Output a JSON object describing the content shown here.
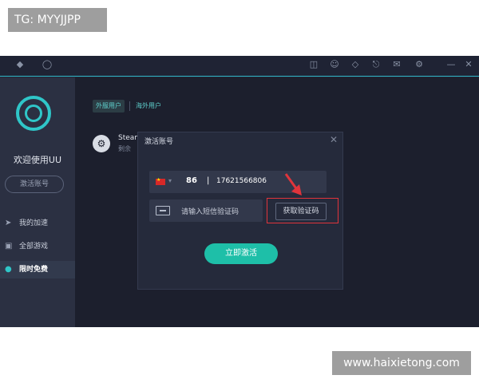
{
  "watermarks": {
    "top": "TG: MYYJJPP",
    "bottom": "www.haixietong.com"
  },
  "titlebar": {
    "icons": [
      "game-controller-icon",
      "gamepad-icon",
      "cart-icon",
      "chat-icon",
      "tag-icon",
      "headset-icon",
      "message-icon",
      "settings-icon",
      "minimize-icon",
      "close-icon"
    ]
  },
  "sidebar": {
    "welcome": "欢迎使用UU",
    "activate_button": "激活账号",
    "nav": [
      {
        "label": "我的加速",
        "icon": "rocket-icon"
      },
      {
        "label": "全部游戏",
        "icon": "controller-icon"
      },
      {
        "label": "限时免费",
        "icon": "clock-icon"
      }
    ]
  },
  "main": {
    "tabs": [
      "外服用户",
      "海外用户"
    ],
    "game": {
      "name": "Steam",
      "sub": "剩余"
    }
  },
  "dialog": {
    "title": "激活账号",
    "country_code": "86",
    "separator": "|",
    "phone": "17621566806",
    "sms_placeholder": "请输入短信验证码",
    "get_code_button": "获取验证码",
    "activate_button": "立即激活"
  },
  "colors": {
    "accent": "#2fc6c8",
    "button": "#1ebfa8",
    "highlight": "#e0343b"
  }
}
